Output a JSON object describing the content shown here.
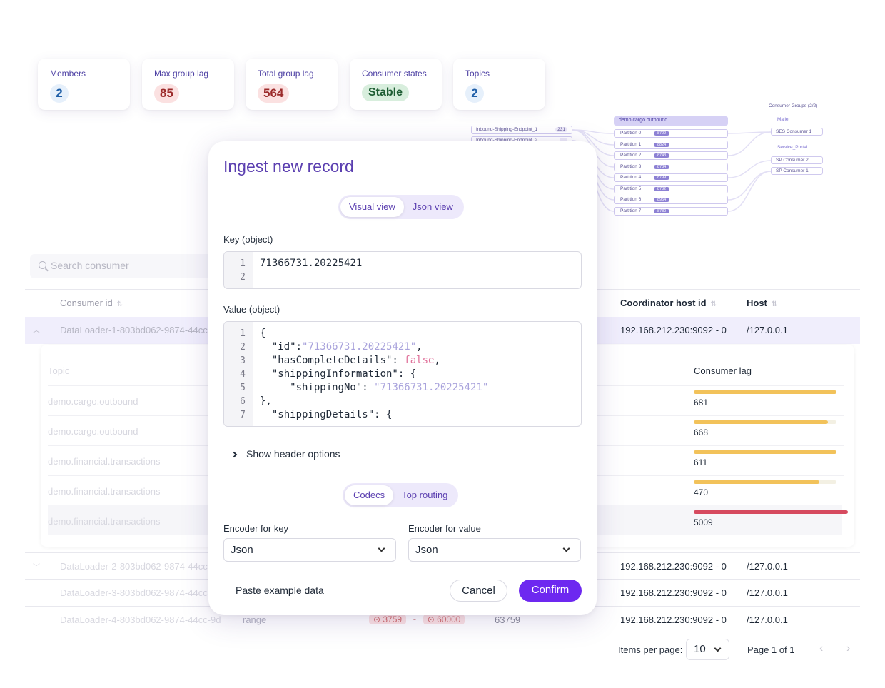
{
  "stats": [
    {
      "label": "Members",
      "value": "2",
      "tone": "blue"
    },
    {
      "label": "Max group lag",
      "value": "85",
      "tone": "red"
    },
    {
      "label": "Total group lag",
      "value": "564",
      "tone": "red"
    },
    {
      "label": "Consumer states",
      "value": "Stable",
      "tone": "green"
    },
    {
      "label": "Topics",
      "value": "2",
      "tone": "blue"
    }
  ],
  "topology": {
    "sources": [
      {
        "name": "Inbound-Shipping-Endpoint_1",
        "count": "231"
      },
      {
        "name": "Inbound-Shipping-Endpoint_2",
        "count": "..."
      }
    ],
    "topic": "demo.cargo.outbound",
    "partitions": [
      {
        "label": "Partition 0",
        "count": "8722"
      },
      {
        "label": "Partition 1",
        "count": "8824"
      },
      {
        "label": "Partition 2",
        "count": "8743"
      },
      {
        "label": "Partition 3",
        "count": "8734"
      },
      {
        "label": "Partition 4",
        "count": "8799"
      },
      {
        "label": "Partition 5",
        "count": "8782"
      },
      {
        "label": "Partition 6",
        "count": "8954"
      },
      {
        "label": "Partition 7",
        "count": "8780"
      }
    ],
    "groups_title": "Consumer Groups (2/2)",
    "groups": [
      {
        "name": "Mailer",
        "consumers": [
          "SES Consumer 1"
        ]
      },
      {
        "name": "Service_Portal",
        "consumers": [
          "SP Consumer 2",
          "SP Consumer 1"
        ]
      }
    ]
  },
  "table": {
    "search_placeholder": "Search consumer",
    "headers": {
      "consumer_id": "Consumer id",
      "coordinator_host_id": "Coordinator host id",
      "host": "Host"
    },
    "rows": [
      {
        "consumer_id": "DataLoader-1-803bd062-9874-44cc-",
        "coordinator": "192.168.212.230:9092 - 0",
        "host": "/127.0.0.1"
      },
      {
        "consumer_id": "DataLoader-2-803bd062-9874-44cc-",
        "coordinator": "192.168.212.230:9092 - 0",
        "host": "/127.0.0.1"
      },
      {
        "consumer_id": "DataLoader-3-803bd062-9874-44cc-",
        "coordinator": "192.168.212.230:9092 - 0",
        "host": "/127.0.0.1"
      },
      {
        "consumer_id": "DataLoader-4-803bd062-9874-44cc-9d",
        "assignment": "range",
        "lag_from": "3759",
        "lag_to": "60000",
        "total": "63759",
        "coordinator": "192.168.212.230:9092 - 0",
        "host": "/127.0.0.1"
      }
    ],
    "expanded": {
      "topic_header": "Topic",
      "lag_header": "Consumer lag",
      "rows": [
        {
          "topic": "demo.cargo.outbound",
          "lag": "681",
          "fill": 1.0,
          "color": "#f2c25a"
        },
        {
          "topic": "demo.cargo.outbound",
          "lag": "668",
          "fill": 0.94,
          "color": "#f2c25a"
        },
        {
          "topic": "demo.financial.transactions",
          "lag": "611",
          "fill": 1.0,
          "color": "#f2c25a"
        },
        {
          "topic": "demo.financial.transactions",
          "lag": "470",
          "fill": 0.88,
          "color": "#f2c25a"
        },
        {
          "topic": "demo.financial.transactions",
          "lag": "5009",
          "fill": 1.0,
          "color": "#d64a5f"
        }
      ]
    }
  },
  "pagination": {
    "items_per_page_label": "Items per page:",
    "items_per_page": "10",
    "page_label": "Page 1 of 1"
  },
  "modal": {
    "title": "Ingest new record",
    "view_tabs": [
      "Visual view",
      "Json view"
    ],
    "key_label": "Key (object)",
    "key_lines": [
      "71366731.20225421",
      ""
    ],
    "value_label": "Value (object)",
    "value_lines": [
      "{",
      "  \"id\":\"71366731.20225421\",",
      "  \"hasCompleteDetails\": false,",
      "  \"shippingInformation\": {",
      "     \"shippingNo\": \"71366731.20225421\"",
      "},",
      "  \"shippingDetails\": {"
    ],
    "show_header_options": "Show header options",
    "codec_tabs": [
      "Codecs",
      "Top routing"
    ],
    "encoder_key_label": "Encoder for key",
    "encoder_key_value": "Json",
    "encoder_value_label": "Encoder for value",
    "encoder_value_value": "Json",
    "paste_example": "Paste example data",
    "cancel": "Cancel",
    "confirm": "Confirm",
    "accent": "#6d28f0"
  }
}
